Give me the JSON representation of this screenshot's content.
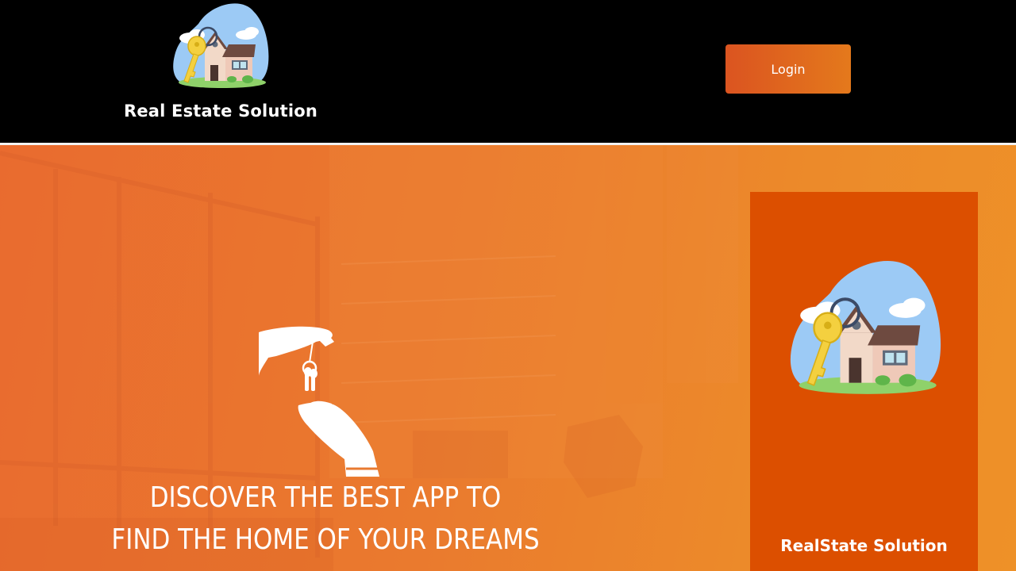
{
  "header": {
    "brand_name": "Real Estate Solution",
    "login_label": "Login",
    "logo_icon": "house-with-key-icon"
  },
  "hero": {
    "headline_line1": "DISCOVER THE BEST APP TO",
    "headline_line2": "FIND THE HOME OF YOUR DREAMS",
    "illustration_icon": "hands-handing-keys-icon"
  },
  "app_card": {
    "brand_name": "RealState Solution",
    "logo_icon": "house-with-key-icon"
  },
  "colors": {
    "header_bg": "#000000",
    "accent": "#dc4f00",
    "button_gradient_start": "#db5420",
    "button_gradient_end": "#e4791c",
    "hero_orange": "#ea7a2e"
  }
}
